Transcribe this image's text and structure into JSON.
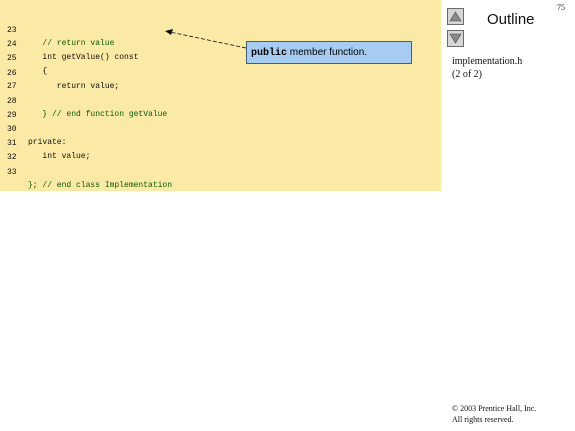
{
  "code": [
    {
      "line": "23",
      "text": "   // return value",
      "comment": true
    },
    {
      "line": "24",
      "text": "   int getValue() const",
      "comment": false
    },
    {
      "line": "25",
      "text": "   {",
      "comment": false
    },
    {
      "line": "26",
      "text": "      return value;",
      "comment": false
    },
    {
      "line": "27",
      "text": "",
      "comment": false
    },
    {
      "line": "28",
      "text": "   } // end function getValue",
      "comment": true
    },
    {
      "line": "29",
      "text": "",
      "comment": false
    },
    {
      "line": "30",
      "text": "private:",
      "comment": false
    },
    {
      "line": "31",
      "text": "   int value;",
      "comment": false
    },
    {
      "line": "32",
      "text": "",
      "comment": false
    },
    {
      "line": "33",
      "text": "}; // end class Implementation",
      "comment": true
    }
  ],
  "callout": {
    "keyword": "public",
    "text": " member function."
  },
  "outline": {
    "title": "Outline",
    "page_number": "75",
    "up_icon": "triangle-up-icon",
    "down_icon": "triangle-down-icon"
  },
  "file": {
    "name": "implementation.h",
    "part": "(2 of 2)"
  },
  "copyright": {
    "line1": "© 2003 Prentice Hall, Inc.",
    "line2": "All rights reserved."
  },
  "colors": {
    "code_background": "#fbe9a6",
    "callout_background": "#a6ccf2"
  }
}
